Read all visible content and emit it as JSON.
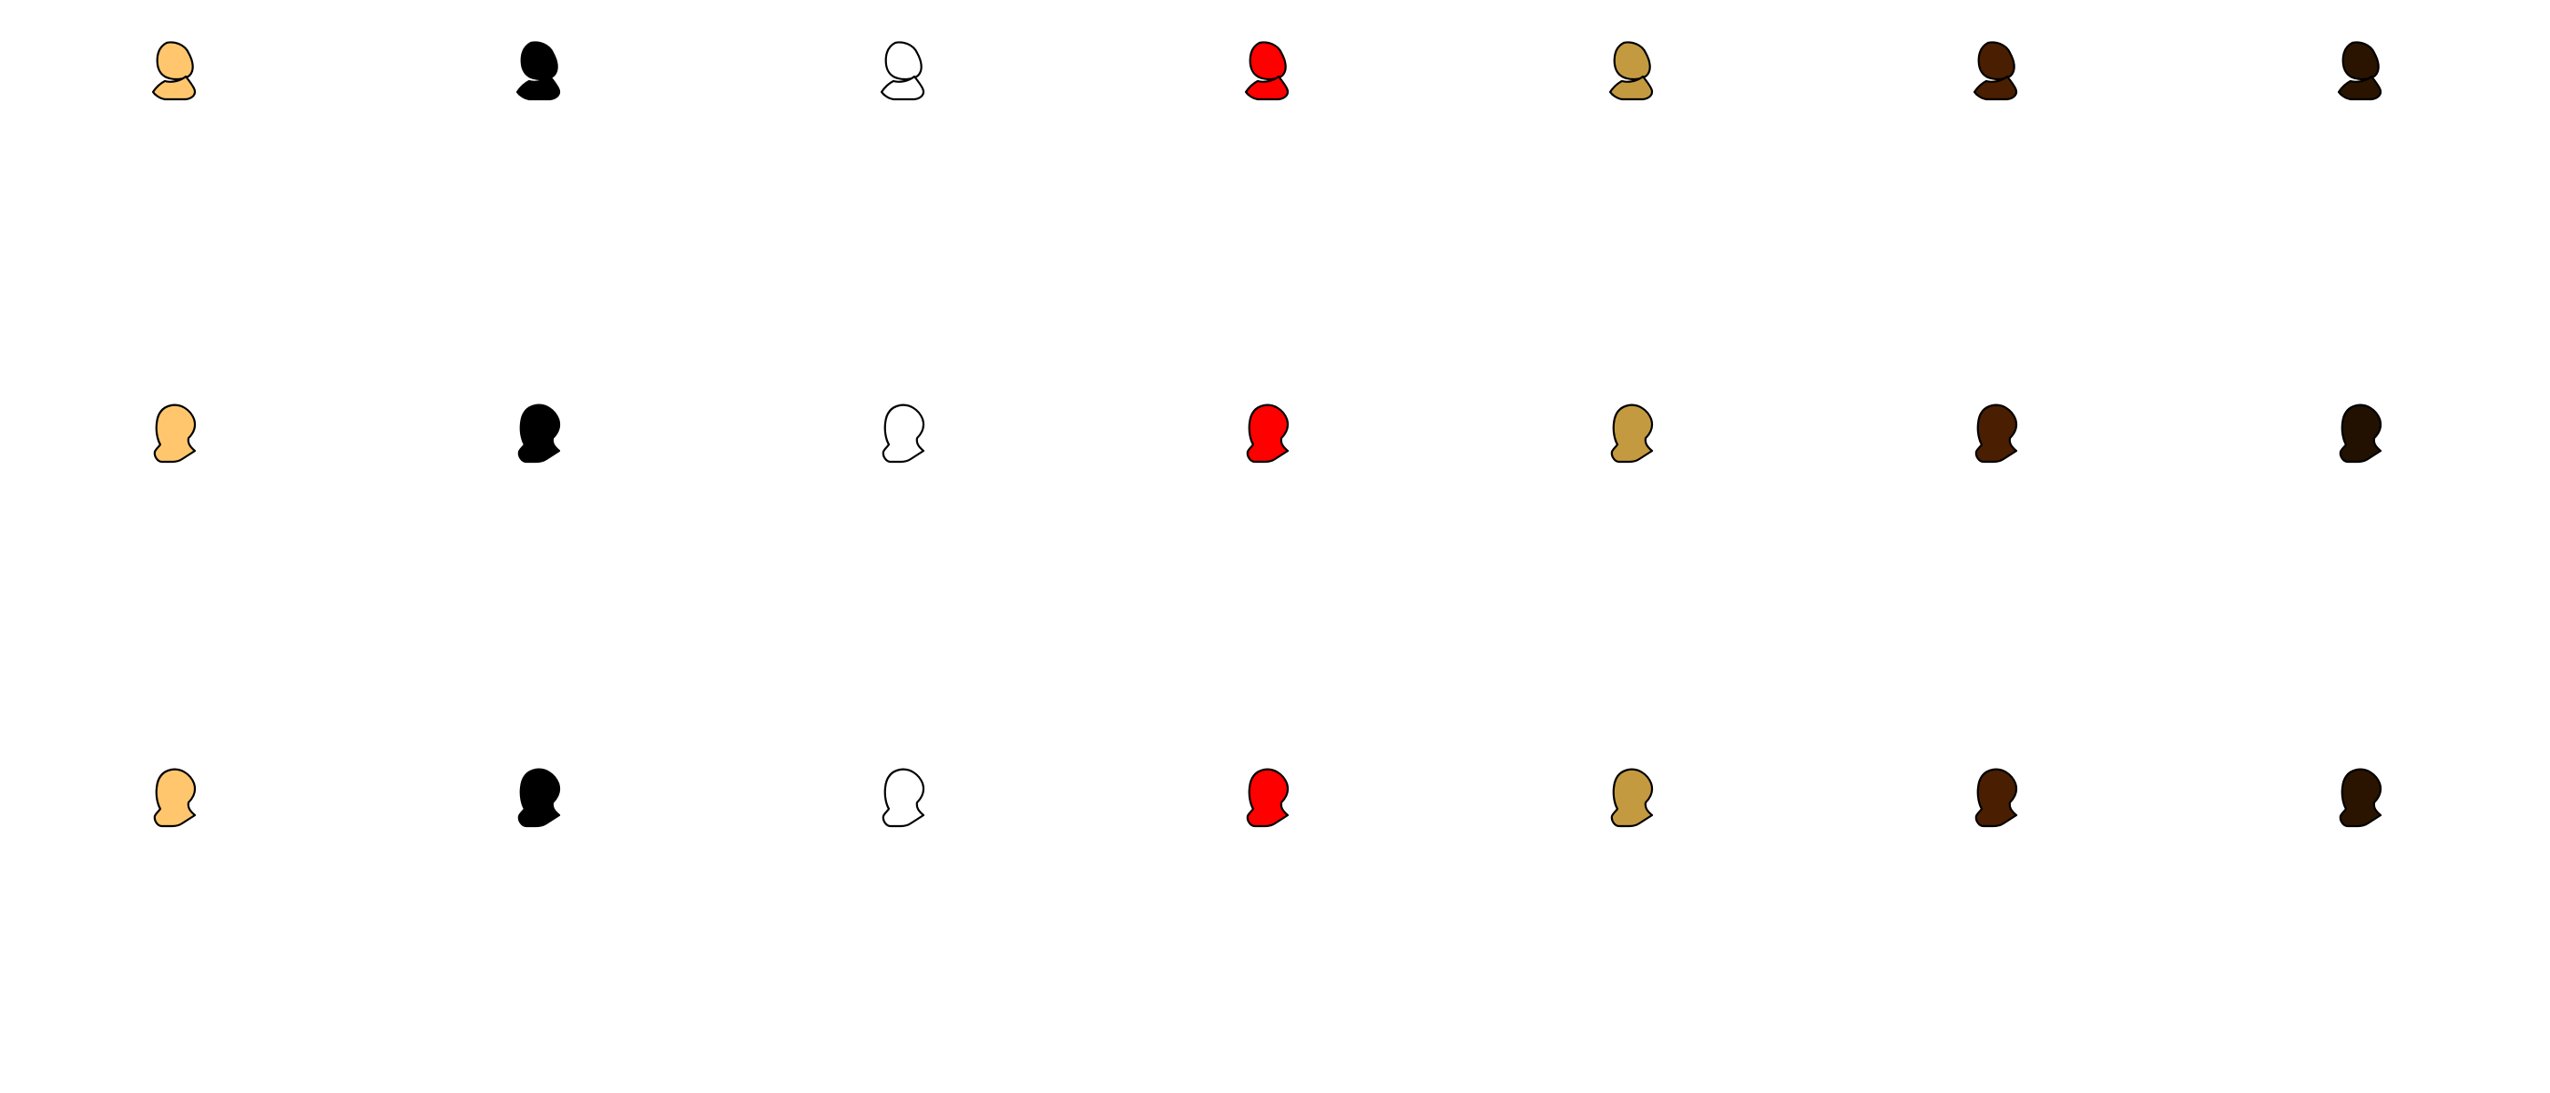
{
  "silhouette_grid": {
    "rows": [
      {
        "style": "head-and-shoulders",
        "items": [
          {
            "fill": "#FFC66E"
          },
          {
            "fill": "#000000"
          },
          {
            "fill": "#FFFFFF"
          },
          {
            "fill": "#FF0000"
          },
          {
            "fill": "#C49A40"
          },
          {
            "fill": "#4A1E00"
          },
          {
            "fill": "#2A1400"
          }
        ]
      },
      {
        "style": "bust",
        "items": [
          {
            "fill": "#FFC66E"
          },
          {
            "fill": "#000000"
          },
          {
            "fill": "#FFFFFF"
          },
          {
            "fill": "#FF0000"
          },
          {
            "fill": "#C49A40"
          },
          {
            "fill": "#4A1E00"
          },
          {
            "fill": "#221000"
          }
        ]
      },
      {
        "style": "bust",
        "items": [
          {
            "fill": "#FFC66E"
          },
          {
            "fill": "#000000"
          },
          {
            "fill": "#FFFFFF"
          },
          {
            "fill": "#FF0000"
          },
          {
            "fill": "#C49A40"
          },
          {
            "fill": "#4A1E00"
          },
          {
            "fill": "#2A1400"
          }
        ]
      }
    ]
  }
}
